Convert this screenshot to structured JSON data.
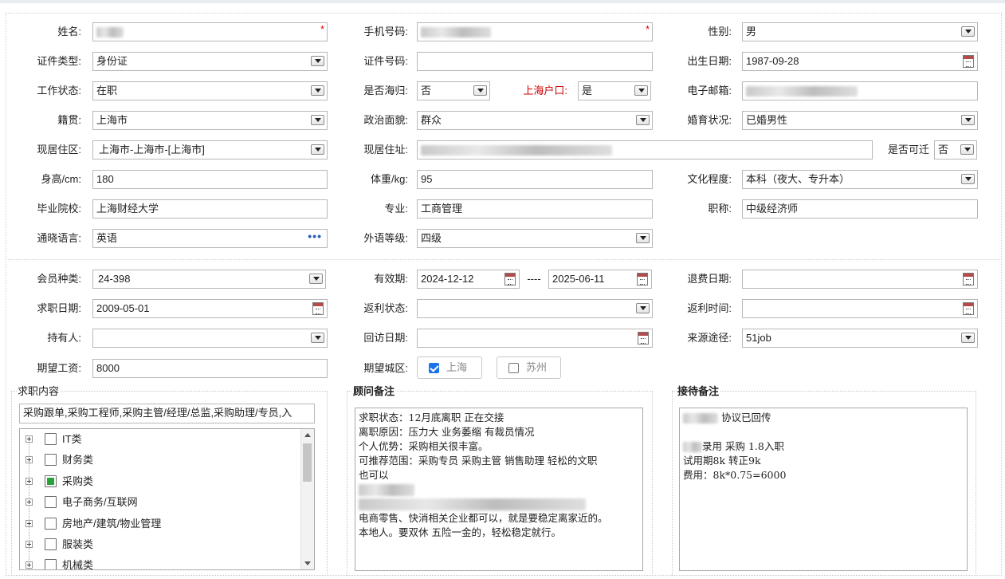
{
  "form": {
    "name": {
      "label": "姓名:",
      "value": ""
    },
    "phone": {
      "label": "手机号码:",
      "value": ""
    },
    "gender": {
      "label": "性别:",
      "value": "男"
    },
    "id_type": {
      "label": "证件类型:",
      "value": "身份证"
    },
    "id_no": {
      "label": "证件号码:",
      "value": ""
    },
    "birth": {
      "label": "出生日期:",
      "value": "1987-09-28"
    },
    "work_status": {
      "label": "工作状态:",
      "value": "在职"
    },
    "returnee": {
      "label": "是否海归:",
      "value": "否"
    },
    "shanghai_hukou": {
      "label": "上海户口:",
      "value": "是"
    },
    "email": {
      "label": "电子邮箱:",
      "value": ""
    },
    "native": {
      "label": "籍贯:",
      "value": "上海市"
    },
    "political": {
      "label": "政治面貌:",
      "value": "群众"
    },
    "marital": {
      "label": "婚育状况:",
      "value": "已婚男性"
    },
    "residence_area": {
      "label": "现居住区:",
      "value": "上海市-上海市-[上海市]"
    },
    "address": {
      "label": "现居住址:",
      "value": ""
    },
    "relocate": {
      "label": "是否可迁",
      "value": "否"
    },
    "height": {
      "label": "身高/cm:",
      "value": "180"
    },
    "weight": {
      "label": "体重/kg:",
      "value": "95"
    },
    "education": {
      "label": "文化程度:",
      "value": "本科（夜大、专升本）"
    },
    "school": {
      "label": "毕业院校:",
      "value": "上海财经大学"
    },
    "major": {
      "label": "专业:",
      "value": "工商管理"
    },
    "title": {
      "label": "职称:",
      "value": "中级经济师"
    },
    "language": {
      "label": "通晓语言:",
      "value": "英语"
    },
    "lang_level": {
      "label": "外语等级:",
      "value": "四级"
    }
  },
  "member": {
    "type": {
      "label": "会员种类:",
      "value": "24-398"
    },
    "validity": {
      "label": "有效期:",
      "start": "2024-12-12",
      "sep": "----",
      "end": "2025-06-11"
    },
    "refund_date": {
      "label": "退费日期:",
      "value": ""
    },
    "job_date": {
      "label": "求职日期:",
      "value": "2009-05-01"
    },
    "rebate_status": {
      "label": "返利状态:",
      "value": ""
    },
    "rebate_time": {
      "label": "返利时间:",
      "value": ""
    },
    "holder": {
      "label": "持有人:",
      "value": ""
    },
    "visit_date": {
      "label": "回访日期:",
      "value": ""
    },
    "source": {
      "label": "来源途径:",
      "value": "51job"
    },
    "salary": {
      "label": "期望工资:",
      "value": "8000"
    },
    "city_label": "期望城区:",
    "cities": [
      {
        "label": "上海",
        "checked": true
      },
      {
        "label": "苏州",
        "checked": false
      }
    ]
  },
  "job_content": {
    "legend": "求职内容",
    "summary": "采购跟单,采购工程师,采购主管/经理/总监,采购助理/专员,入",
    "tree": [
      {
        "label": "IT类",
        "state": "none"
      },
      {
        "label": "财务类",
        "state": "none"
      },
      {
        "label": "采购类",
        "state": "partial"
      },
      {
        "label": "电子商务/互联网",
        "state": "none"
      },
      {
        "label": "房地产/建筑/物业管理",
        "state": "none"
      },
      {
        "label": "服装类",
        "state": "none"
      },
      {
        "label": "机械类",
        "state": "none"
      }
    ]
  },
  "consultant_notes": {
    "legend": "顾问备注",
    "lines": [
      "求职状态：12月底离职 正在交接",
      "离职原因：压力大 业务萎缩 有裁员情况",
      "个人优势：采购相关很丰富。",
      "可推荐范围：采购专员 采购主管 销售助理 轻松的文职",
      "也可以",
      "",
      "",
      "电商零售、快消相关企业都可以，就是要稳定离家近的。",
      "本地人。要双休 五险一金的，轻松稳定就行。"
    ]
  },
  "reception_notes": {
    "legend": "接待备注",
    "lines": [
      " 协议已回传",
      "",
      "录用 采购  1.8入职",
      "试用期8k 转正9k",
      "费用：8k*0.75=6000"
    ]
  },
  "colors": {
    "required": "#e00000",
    "hukou_label": "#d00000",
    "checkbox_on": "#1a73e8",
    "tree_partial": "#27a33a"
  }
}
